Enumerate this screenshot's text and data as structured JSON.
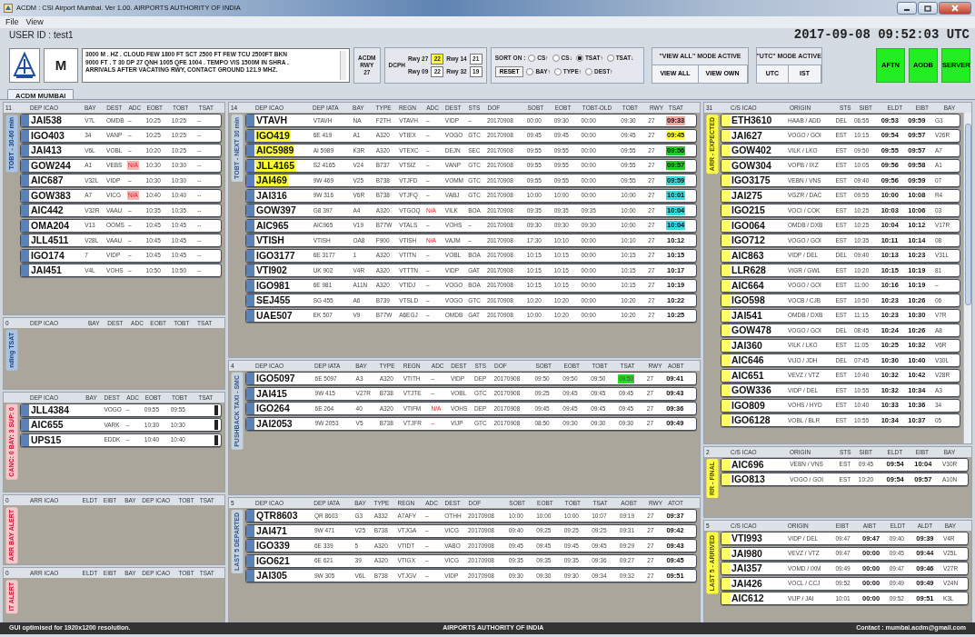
{
  "window": {
    "title": "ACDM : CSI Airport Mumbai. Ver 1.00. AIRPORTS AUTHORITY OF INDIA"
  },
  "menu": [
    "File",
    "View"
  ],
  "user_id": "USER ID : test1",
  "clock": "2017-09-08 09:52:03 UTC",
  "toolbar": {
    "logo_letter": "M",
    "metar_lines": [
      "3000 M . HZ . CLOUD FEW 1800 FT  SCT 2500 FT FEW TCU 2500FT BKN",
      "9000 FT . T 30 DP 27 QNH 1005 QFE 1004 . TEMPO VIS 1500M IN SHRA .",
      "ARRIVALS AFTER VACATING RWY, CONTACT GROUND 121.9 MHZ."
    ],
    "acdm_rwy": [
      "ACDM",
      "RWY",
      "27"
    ],
    "dcph": {
      "label": "DCPH",
      "runways": [
        {
          "label": "Rwy 27",
          "value": "22",
          "highlighted": true
        },
        {
          "label": "Rwy 14",
          "value": "21",
          "highlighted": false
        },
        {
          "label": "Rwy 09",
          "value": "22",
          "highlighted": false
        },
        {
          "label": "Rwy 32",
          "value": "19",
          "highlighted": false
        }
      ]
    },
    "sort": {
      "label": "SORT ON :",
      "reset": "RESET",
      "option_rows": [
        [
          {
            "label": "CS↑",
            "selected": false
          },
          {
            "label": "CS↓",
            "selected": false
          },
          {
            "label": "TSAT↑",
            "selected": true
          },
          {
            "label": "TSAT↓",
            "selected": false
          }
        ],
        [
          {
            "label": "BAY↑",
            "selected": false
          },
          {
            "label": "TYPE↑",
            "selected": false
          },
          {
            "label": "DEST↑",
            "selected": false
          }
        ]
      ]
    },
    "view_mode": {
      "label": "\"VIEW ALL\" MODE ACTIVE",
      "buttons": [
        "VIEW ALL",
        "VIEW OWN"
      ]
    },
    "time_mode": {
      "label": "\"UTC\" MODE ACTIVE",
      "buttons": [
        "UTC",
        "IST"
      ]
    },
    "status_buttons": [
      {
        "label": "AFTN",
        "on": true
      },
      {
        "label": "AODB",
        "on": true
      },
      {
        "label": "SERVER",
        "on": true
      }
    ]
  },
  "tab": "ACDM MUMBAI",
  "left_panels": [
    {
      "count": "11",
      "label": "TOBT - 30-60 min",
      "kind": "pending",
      "columns": [
        {
          "label": "DEP ICAO"
        },
        {
          "label": "BAY"
        },
        {
          "label": "DEST"
        },
        {
          "label": "ADC"
        },
        {
          "label": "EOBT"
        },
        {
          "label": "TOBT"
        },
        {
          "label": "TSAT"
        }
      ],
      "rows": [
        [
          "JAI538",
          "V7L",
          "OMDB",
          "–",
          "10:25",
          "10:25",
          "--"
        ],
        [
          "IGO403",
          "34",
          "VANP",
          "–",
          "10:25",
          "10:25",
          "--"
        ],
        [
          "JAI413",
          "V6L",
          "VOBL",
          "–",
          "10:20",
          "10:25",
          "--"
        ],
        [
          "GOW244",
          "A1",
          "VEBS",
          {
            "text": "N/A",
            "kind": "alert",
            "color": "#f5b3b3"
          },
          "10:30",
          "10:30",
          "--"
        ],
        [
          "AIC687",
          "V32L",
          "VIDP",
          "–",
          "10:30",
          "10:30",
          "--"
        ],
        [
          "GOW383",
          "A7",
          "VICG",
          {
            "text": "N/A",
            "kind": "alert",
            "color": "#f5b3b3"
          },
          "10:40",
          "10:40",
          "--"
        ],
        [
          "AIC442",
          "V32R",
          "VAAU",
          "–",
          "10:35",
          "10:35",
          "--"
        ],
        [
          "OMA204",
          "V13",
          "OOMS",
          "–",
          "10:45",
          "10:45",
          "--"
        ],
        [
          "JLL4511",
          "V28L",
          "VAAU",
          "–",
          "10:45",
          "10:45",
          "--"
        ],
        [
          "IGO174",
          "7",
          "VIDP",
          "–",
          "10:45",
          "10:45",
          "--"
        ],
        [
          "JAI451",
          "V4L",
          "VOHS",
          "–",
          "10:50",
          "10:50",
          "--"
        ]
      ]
    },
    {
      "count": "0",
      "label": "nding TSAT",
      "kind": "pending",
      "columns": [
        {
          "label": "DEP ICAO"
        },
        {
          "label": "BAY"
        },
        {
          "label": "DEST"
        },
        {
          "label": "ADC"
        },
        {
          "label": "EOBT"
        },
        {
          "label": "TOBT"
        },
        {
          "label": "TSAT"
        }
      ]
    },
    {
      "label": "CANC: 0  BAY: 3  SUP: 0",
      "kind": "alert",
      "columns": [
        {
          "label": "DEP ICAO"
        },
        {
          "label": "BAY"
        },
        {
          "label": "DEST"
        },
        {
          "label": "ADC"
        },
        {
          "label": "EOBT"
        },
        {
          "label": "TOBT"
        },
        {
          "label": "TSAT"
        }
      ],
      "rows": [
        [
          "JLL4384",
          null,
          "VOGO",
          "–",
          "09:55",
          "09:55",
          {
            "kind": "block"
          }
        ],
        [
          "AIC655",
          null,
          "VARK",
          "–",
          "10:30",
          "10:30",
          {
            "kind": "block"
          }
        ],
        [
          "UPS15",
          null,
          "EDDK",
          "–",
          "10:40",
          "10:40",
          {
            "kind": "block"
          }
        ]
      ]
    },
    {
      "count": "0",
      "label": "ARR BAY ALERT",
      "kind": "alert",
      "columns": [
        {
          "label": "ARR ICAO"
        },
        {
          "label": "ELDT"
        },
        {
          "label": "EIBT"
        },
        {
          "label": "BAY"
        },
        {
          "label": "DEP ICAO"
        },
        {
          "label": "TOBT"
        },
        {
          "label": "TSAT"
        }
      ]
    },
    {
      "count": "0",
      "label": "IT ALERT",
      "kind": "alert",
      "columns": [
        {
          "label": "ARR ICAO"
        },
        {
          "label": "ELDT"
        },
        {
          "label": "EIBT"
        },
        {
          "label": "BAY"
        },
        {
          "label": "DEP ICAO"
        },
        {
          "label": "TOBT"
        },
        {
          "label": "TSAT"
        }
      ]
    }
  ],
  "middle_panels": [
    {
      "count": "14",
      "label": "TOBT - NEXT 30 min",
      "kind": "departure",
      "columns": [
        {
          "label": "DEP ICAO"
        },
        {
          "label": "DEP IATA"
        },
        {
          "label": "BAY"
        },
        {
          "label": "TYPE"
        },
        {
          "label": "REGN"
        },
        {
          "label": "ADC"
        },
        {
          "label": "DEST"
        },
        {
          "label": "STS"
        },
        {
          "label": "DOF"
        },
        {
          "label": "SOBT"
        },
        {
          "label": "EOBT"
        },
        {
          "label": "TOBT-OLD"
        },
        {
          "label": "TOBT"
        },
        {
          "label": "RWY"
        },
        {
          "label": "TSAT",
          "bold": true
        }
      ],
      "rows": [
        [
          "VTAVH",
          "VTAVH",
          "NA",
          "F2TH",
          "VTAVH",
          "–",
          "VIDP",
          "–",
          "20170908",
          "00:00",
          "09:30",
          "00:00",
          "09:30",
          "27",
          {
            "text": "09:33",
            "color": "#f4a3a3"
          }
        ],
        [
          {
            "text": "IGO419",
            "color": "#ffff33"
          },
          "6E 419",
          "A1",
          "A320",
          "VTIEX",
          "–",
          "VOGO",
          "GTC",
          "20170908",
          "09:45",
          "09:45",
          "00:00",
          "09:45",
          "27",
          {
            "text": "09:45",
            "color": "#ffff33"
          }
        ],
        [
          {
            "text": "AIC5989",
            "color": "#ffff33"
          },
          "AI 5989",
          "K3R",
          "A320",
          "VTEXC",
          "–",
          "DEJN",
          "SEC",
          "20170908",
          "09:55",
          "09:55",
          "00:00",
          "09:55",
          "27",
          {
            "text": "09:56",
            "color": "#22cc22"
          }
        ],
        [
          {
            "text": "JLL4165",
            "color": "#ffff33"
          },
          "S2 4165",
          "V24",
          "B737",
          "VTSIZ",
          "–",
          "VANP",
          "GTC",
          "20170908",
          "09:55",
          "09:55",
          "00:00",
          "09:55",
          "27",
          {
            "text": "09:57",
            "color": "#22cc22"
          }
        ],
        [
          {
            "text": "JAI469",
            "color": "#ffff33"
          },
          "9W 469",
          "V25",
          "B738",
          "VTJFD",
          "–",
          "VOMM",
          "GTC",
          "20170908",
          "09:55",
          "09:55",
          "00:00",
          "09:55",
          "27",
          {
            "text": "09:59",
            "color": "#33dddd"
          }
        ],
        [
          "JAI316",
          "9W 316",
          "V6R",
          "B738",
          "VTJFQ",
          "–",
          "VABJ",
          "GTC",
          "20170908",
          "10:00",
          "10:00",
          "00:00",
          "10:00",
          "27",
          {
            "text": "10:01",
            "color": "#33dddd"
          }
        ],
        [
          "GOW397",
          "G8 397",
          "A4",
          "A320",
          "VTGOQ",
          {
            "text": "N/A",
            "kind": "alert"
          },
          "VILK",
          "BOA",
          "20170908",
          "09:35",
          "09:35",
          "09:35",
          "10:00",
          "27",
          {
            "text": "10:04",
            "color": "#33dddd"
          }
        ],
        [
          "AIC965",
          "AIC965",
          "V19",
          "B77W",
          "VTALS",
          "–",
          "VOHS",
          "–",
          "20170908",
          "09:30",
          "09:30",
          "09:30",
          "10:00",
          "27",
          {
            "text": "10:04",
            "color": "#33dddd"
          }
        ],
        [
          "VTISH",
          "VTISH",
          "OA8",
          "F900",
          "VTISH",
          {
            "text": "N/A",
            "kind": "alert"
          },
          "VAJM",
          "–",
          "20170908",
          "17:30",
          "10:10",
          "00:00",
          "10:10",
          "27",
          "10:12"
        ],
        [
          "IGO3177",
          "6E 3177",
          "1",
          "A320",
          "VTITN",
          "–",
          "VOBL",
          "BOA",
          "20170908",
          "10:15",
          "10:15",
          "00:00",
          "10:15",
          "27",
          "10:15"
        ],
        [
          "VTI902",
          "UK 902",
          "V4R",
          "A320",
          "VTTTN",
          "–",
          "VIDP",
          "GAT",
          "20170908",
          "10:15",
          "10:15",
          "00:00",
          "10:15",
          "27",
          "10:17"
        ],
        [
          "IGO981",
          "6E 981",
          "A11N",
          "A320",
          "VTIDJ",
          "–",
          "VOGO",
          "BOA",
          "20170908",
          "10:15",
          "10:15",
          "00:00",
          "10:15",
          "27",
          "10:19"
        ],
        [
          "SEJ455",
          "SG 455",
          "A6",
          "B739",
          "VTSLD",
          "–",
          "VOGO",
          "GTC",
          "20170908",
          "10:20",
          "10:20",
          "00:00",
          "10:20",
          "27",
          "10:22"
        ],
        [
          "UAE507",
          "EK 507",
          "V9",
          "B77W",
          "A6EGJ",
          "–",
          "OMDB",
          "GAT",
          "20170908",
          "10:00",
          "10:20",
          "00:00",
          "10:20",
          "27",
          "10:25"
        ]
      ]
    },
    {
      "count": "4",
      "label": "PUSHBACK TAXI - SMC",
      "kind": "departure",
      "columns": [
        {
          "label": "DEP ICAO"
        },
        {
          "label": "DEP IATA"
        },
        {
          "label": "BAY"
        },
        {
          "label": "TYPE"
        },
        {
          "label": "REGN"
        },
        {
          "label": "ADC"
        },
        {
          "label": "DEST"
        },
        {
          "label": "STS"
        },
        {
          "label": "DOF"
        },
        {
          "label": "SOBT"
        },
        {
          "label": "EOBT"
        },
        {
          "label": "TOBT"
        },
        {
          "label": "TSAT"
        },
        {
          "label": "RWY"
        },
        {
          "label": "AOBT",
          "bold": true
        }
      ],
      "rows": [
        [
          "IGO5097",
          "6E 5097",
          "A3",
          "A320",
          "VTITH",
          "–",
          "VIDP",
          "DEP",
          "20170908",
          "09:50",
          "09:50",
          "09:50",
          {
            "text": "09:50",
            "color": "#22dd22"
          },
          "27",
          "09:41"
        ],
        [
          "JAI415",
          "9W 415",
          "V27R",
          "B738",
          "VTJTE",
          "–",
          "VOBL",
          "GTC",
          "20170908",
          "09:25",
          "09:45",
          "09:45",
          "09:45",
          "27",
          "09:43"
        ],
        [
          "IGO264",
          "6E 264",
          "40",
          "A320",
          "VTIFM",
          {
            "text": "N/A",
            "kind": "alert"
          },
          "VOHS",
          "DEP",
          "20170908",
          "09:45",
          "09:45",
          "09:45",
          "09:45",
          "27",
          "09:36"
        ],
        [
          "JAI2053",
          "9W 2053",
          "V5",
          "B738",
          "VTJFR",
          {
            "text": "–",
            "kind": "alert"
          },
          "VIJP",
          "GTC",
          "20170908",
          "08:50",
          "09:30",
          "09:30",
          "09:30",
          "27",
          "09:49"
        ]
      ]
    },
    {
      "count": "5",
      "label": "LAST 5 DEPARTED",
      "kind": "departure",
      "columns": [
        {
          "label": "DEP ICAO"
        },
        {
          "label": "DEP IATA"
        },
        {
          "label": "BAY"
        },
        {
          "label": "TYPE"
        },
        {
          "label": "REGN"
        },
        {
          "label": "ADC"
        },
        {
          "label": "DEST"
        },
        {
          "label": "DOF"
        },
        {
          "label": "SOBT"
        },
        {
          "label": "EOBT"
        },
        {
          "label": "TOBT"
        },
        {
          "label": "TSAT"
        },
        {
          "label": "AOBT"
        },
        {
          "label": "RWY"
        },
        {
          "label": "ATOT",
          "bold": true
        }
      ],
      "rows": [
        [
          "QTR8603",
          "QR 8603",
          "G3",
          "A332",
          "A7AFY",
          "–",
          "OTHH",
          "20170908",
          "10:00",
          "10:00",
          "10:00",
          "10:07",
          "09:19",
          "27",
          "09:37"
        ],
        [
          "JAI471",
          "9W 471",
          "V25",
          "B738",
          "VTJGA",
          "–",
          "VICG",
          "20170908",
          "09:40",
          "09:25",
          "09:25",
          "09:25",
          "09:31",
          "27",
          "09:42"
        ],
        [
          "IGO339",
          "6E 339",
          "5",
          "A320",
          "VTIDT",
          "–",
          "VABO",
          "20170908",
          "09:45",
          "09:45",
          "09:45",
          "09:45",
          "09:29",
          "27",
          "09:43"
        ],
        [
          "IGO621",
          "6E 621",
          "39",
          "A320",
          "VTIGX",
          "–",
          "VICG",
          "20170908",
          "09:35",
          "09:35",
          "09:35",
          "09:36",
          "09:27",
          "27",
          "09:45"
        ],
        [
          "JAI305",
          "9W 305",
          "V6L",
          "B738",
          "VTJGV",
          "–",
          "VIDP",
          "20170908",
          "09:30",
          "09:30",
          "09:30",
          "09:34",
          "09:32",
          "27",
          "09:51"
        ]
      ]
    }
  ],
  "right_panels": [
    {
      "count": "31",
      "label": "ARR - EXPECTED",
      "kind": "arrival",
      "scrollable": true,
      "columns": [
        {
          "label": "C/S ICAO"
        },
        {
          "label": "ORIGIN"
        },
        {
          "label": "STS"
        },
        {
          "label": "SIBT"
        },
        {
          "label": "ELDT",
          "bold": true
        },
        {
          "label": "EIBT",
          "bold": true
        },
        {
          "label": "BAY"
        }
      ],
      "rows": [
        [
          "ETH3610",
          "HAAB / ADD",
          "DEL",
          "06:55",
          "09:53",
          "09:59",
          "G3"
        ],
        [
          "JAI627",
          "VOGO / GOI",
          "EST",
          "10:15",
          "09:54",
          "09:57",
          "V26R"
        ],
        [
          "GOW402",
          "VILK / LKO",
          "EST",
          "09:50",
          "09:55",
          "09:57",
          "A7"
        ],
        [
          "GOW304",
          "VOPB / IXZ",
          "EST",
          "10:05",
          "09:56",
          "09:58",
          "A1"
        ],
        [
          "IGO3175",
          "VEBN / VNS",
          "EST",
          "09:40",
          "09:56",
          "09:59",
          "07"
        ],
        [
          "JAI275",
          "VGZR / DAC",
          "EST",
          "09:55",
          "10:00",
          "10:08",
          "R4"
        ],
        [
          "IGO215",
          "VOCI / COK",
          "EST",
          "10:25",
          "10:03",
          "10:06",
          "03"
        ],
        [
          "IGO064",
          "OMDB / DXB",
          "EST",
          "10:25",
          "10:04",
          "10:12",
          "V17R"
        ],
        [
          "IGO712",
          "VOGO / GOI",
          "EST",
          "10:35",
          "10:11",
          "10:14",
          "08"
        ],
        [
          "AIC863",
          "VIDP / DEL",
          "DEL",
          "09:40",
          "10:13",
          "10:23",
          "V31L"
        ],
        [
          "LLR628",
          "VIGR / GWL",
          "EST",
          "10:20",
          "10:15",
          "10:19",
          "81"
        ],
        [
          "AIC664",
          "VOGO / GOI",
          "EST",
          "11:00",
          "10:16",
          "10:19",
          "–"
        ],
        [
          "IGO598",
          "VOCB / CJB",
          "EST",
          "10:50",
          "10:23",
          "10:26",
          "06"
        ],
        [
          "JAI541",
          "OMDB / DXB",
          "EST",
          "11:15",
          "10:23",
          "10:30",
          "V7R"
        ],
        [
          "GOW478",
          "VOGO / GOI",
          "DEL",
          "08:45",
          "10:24",
          "10:26",
          "A8"
        ],
        [
          "JAI360",
          "VILK / LKO",
          "EST",
          "11:05",
          "10:25",
          "10:32",
          "V6R"
        ],
        [
          "AIC646",
          "VIJO / JDH",
          "DEL",
          "07:45",
          "10:30",
          "10:40",
          "V30L"
        ],
        [
          "AIC651",
          "VEVZ / VTZ",
          "EST",
          "10:40",
          "10:32",
          "10:42",
          "V28R"
        ],
        [
          "GOW336",
          "VIDP / DEL",
          "EST",
          "10:55",
          "10:32",
          "10:34",
          "A3"
        ],
        [
          "IGO809",
          "VOHS / HYD",
          "EST",
          "10:40",
          "10:33",
          "10:36",
          "34"
        ],
        [
          "IGO6128",
          "VOBL / BLR",
          "EST",
          "10:55",
          "10:34",
          "10:37",
          "05"
        ]
      ]
    },
    {
      "count": "2",
      "label": "RR - FINAL",
      "kind": "arrival",
      "columns": [
        {
          "label": "C/S ICAO"
        },
        {
          "label": "ORIGIN"
        },
        {
          "label": "STS"
        },
        {
          "label": "SIBT"
        },
        {
          "label": "ELDT",
          "bold": true
        },
        {
          "label": "EIBT",
          "bold": true
        },
        {
          "label": "BAY"
        }
      ],
      "rows": [
        [
          "AIC696",
          "VEBN / VNS",
          "EST",
          "09:45",
          "09:54",
          "10:04",
          "V30R"
        ],
        [
          "IGO813",
          "VOGO / GOI",
          "EST",
          "10:20",
          "09:54",
          "09:57",
          "A10N"
        ]
      ]
    },
    {
      "count": "5",
      "label": "LAST 5 - ARRIVED",
      "kind": "arrival",
      "columns": [
        {
          "label": "C/S ICAO"
        },
        {
          "label": "ORIGIN"
        },
        {
          "label": "EIBT"
        },
        {
          "label": "AIBT",
          "bold": true
        },
        {
          "label": "ELDT"
        },
        {
          "label": "ALDT",
          "bold": true
        },
        {
          "label": "BAY"
        }
      ],
      "rows": [
        [
          "VTI993",
          "VIDP / DEL",
          "09:47",
          "09:47",
          "09:40",
          "09:39",
          "V4R"
        ],
        [
          "JAI980",
          "VEVZ / VTZ",
          "09:47",
          "00:00",
          "09:45",
          "09:44",
          "V25L"
        ],
        [
          "JAI357",
          "VOMD / IXM",
          "09:49",
          "00:00",
          "09:47",
          "09:46",
          "V27R"
        ],
        [
          "JAI426",
          "VOCL / CCJ",
          "09:52",
          "00:00",
          "09:49",
          "09:49",
          "V24N"
        ],
        [
          "AIC612",
          "VIJP / JAI",
          "10:01",
          "00:00",
          "09:52",
          "09:51",
          "K3L"
        ]
      ]
    }
  ],
  "footer": {
    "left": "GUI optimised for 1920x1200 resolution.",
    "center": "AIRPORTS AUTHORITY OF INDIA",
    "right": "Contact : mumbai.acdm@gmail.com"
  }
}
